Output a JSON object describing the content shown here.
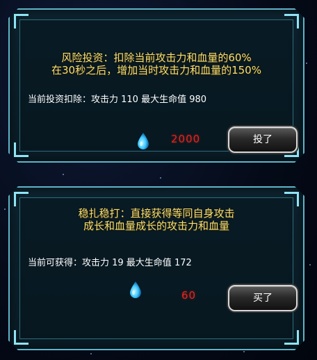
{
  "investment_panel": {
    "title_line1": "风险投资：扣除当前攻击力和血量的60%",
    "title_line2": "在30秒之后，增加当时攻击力和血量的150%",
    "info": "当前投资扣除：攻击力 110   最大生命值 980",
    "cost": "2000",
    "button_label": "投了"
  },
  "steady_panel": {
    "title_line1": "稳扎稳打：直接获得等同自身攻击",
    "title_line2": "成长和血量成长的攻击力和血量",
    "info": "当前可获得：攻击力 19   最大生命值 172",
    "cost": "60",
    "button_label": "买了"
  },
  "colors": {
    "title": "#f3e07a",
    "cost": "#e0241e",
    "panel_border": "#5fb4c8",
    "currency": "#3ec8ff"
  },
  "icons": {
    "currency": "water-drop-icon"
  }
}
